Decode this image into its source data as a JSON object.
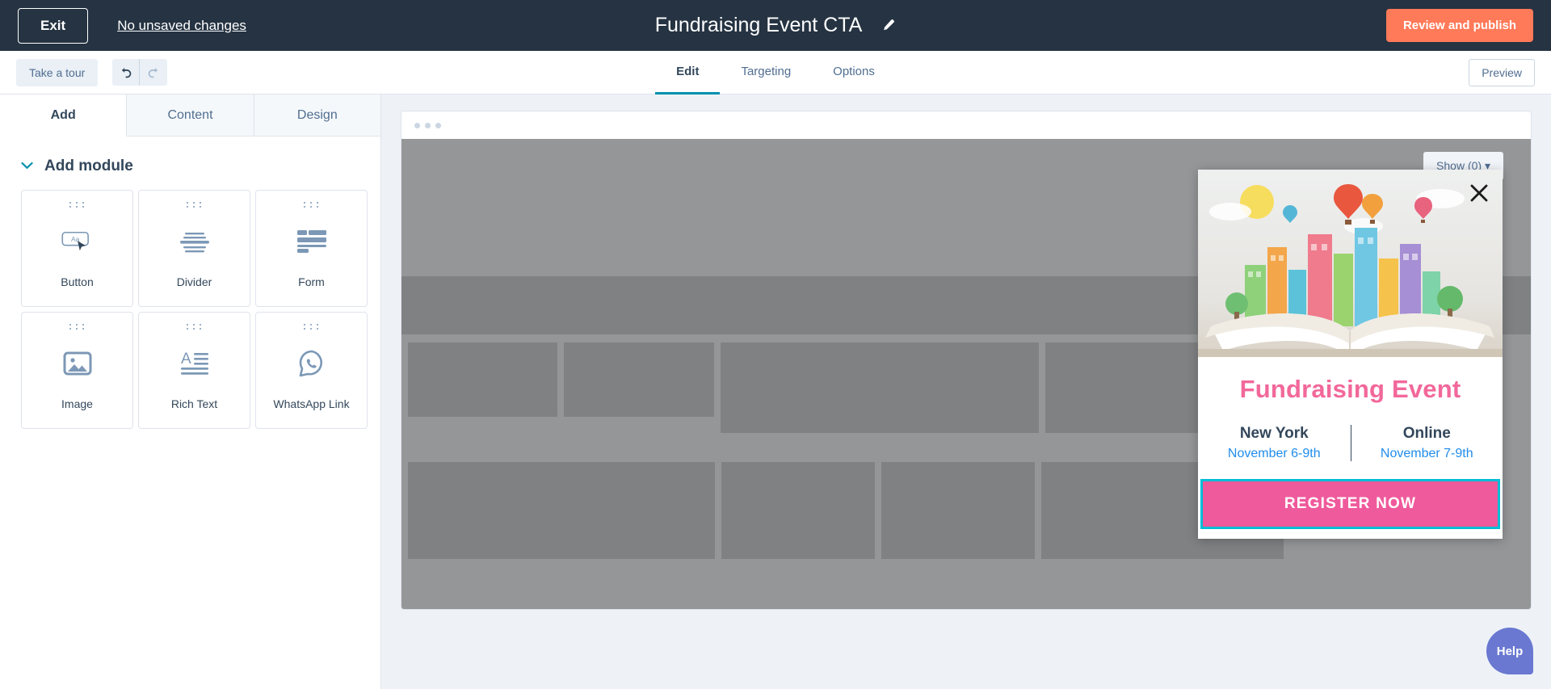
{
  "topbar": {
    "exit_label": "Exit",
    "unsaved_label": "No unsaved changes",
    "title": "Fundraising Event CTA",
    "edit_icon": "pencil-icon",
    "publish_label": "Review and publish",
    "bg_color": "#253342",
    "publish_color": "#ff7a59"
  },
  "subbar": {
    "tour_label": "Take a tour",
    "undo_icon": "undo-arrow-icon",
    "redo_icon": "redo-arrow-icon",
    "preview_label": "Preview",
    "tabs": [
      {
        "label": "Edit",
        "active": true
      },
      {
        "label": "Targeting",
        "active": false
      },
      {
        "label": "Options",
        "active": false
      }
    ],
    "active_color": "#0091ae"
  },
  "sidebar": {
    "tabs": [
      {
        "label": "Add",
        "active": true
      },
      {
        "label": "Content",
        "active": false
      },
      {
        "label": "Design",
        "active": false
      }
    ],
    "section": {
      "title": "Add module",
      "chevron_icon": "chevron-down-icon",
      "chevron_color": "#0091ae",
      "expanded": true
    },
    "modules": [
      {
        "label": "Button",
        "icon": "button-aa-cursor-icon"
      },
      {
        "label": "Divider",
        "icon": "divider-lines-icon"
      },
      {
        "label": "Form",
        "icon": "form-fields-icon"
      },
      {
        "label": "Image",
        "icon": "image-photo-icon"
      },
      {
        "label": "Rich Text",
        "icon": "rich-text-a-lines-icon"
      },
      {
        "label": "WhatsApp Link",
        "icon": "whatsapp-bubble-icon"
      }
    ]
  },
  "canvas": {
    "show_dropdown_label": "Show (0)",
    "dropdown_icon": "caret-down-icon"
  },
  "cta": {
    "close_icon": "close-x-icon",
    "hero_icon": "city-skyline-book-balloons-illustration",
    "headline": "Fundraising Event",
    "headline_color": "#f2689a",
    "events": [
      {
        "place": "New York",
        "date": "November 6-9th"
      },
      {
        "place": "Online",
        "date": "November 7-9th"
      }
    ],
    "place_color": "#33475b",
    "date_color": "#1f8ceb",
    "button_label": "REGISTER NOW",
    "button_color": "#ef5a9c",
    "selection_outline_color": "#00bdd6"
  },
  "help": {
    "label": "Help",
    "color": "#6a78d1"
  }
}
